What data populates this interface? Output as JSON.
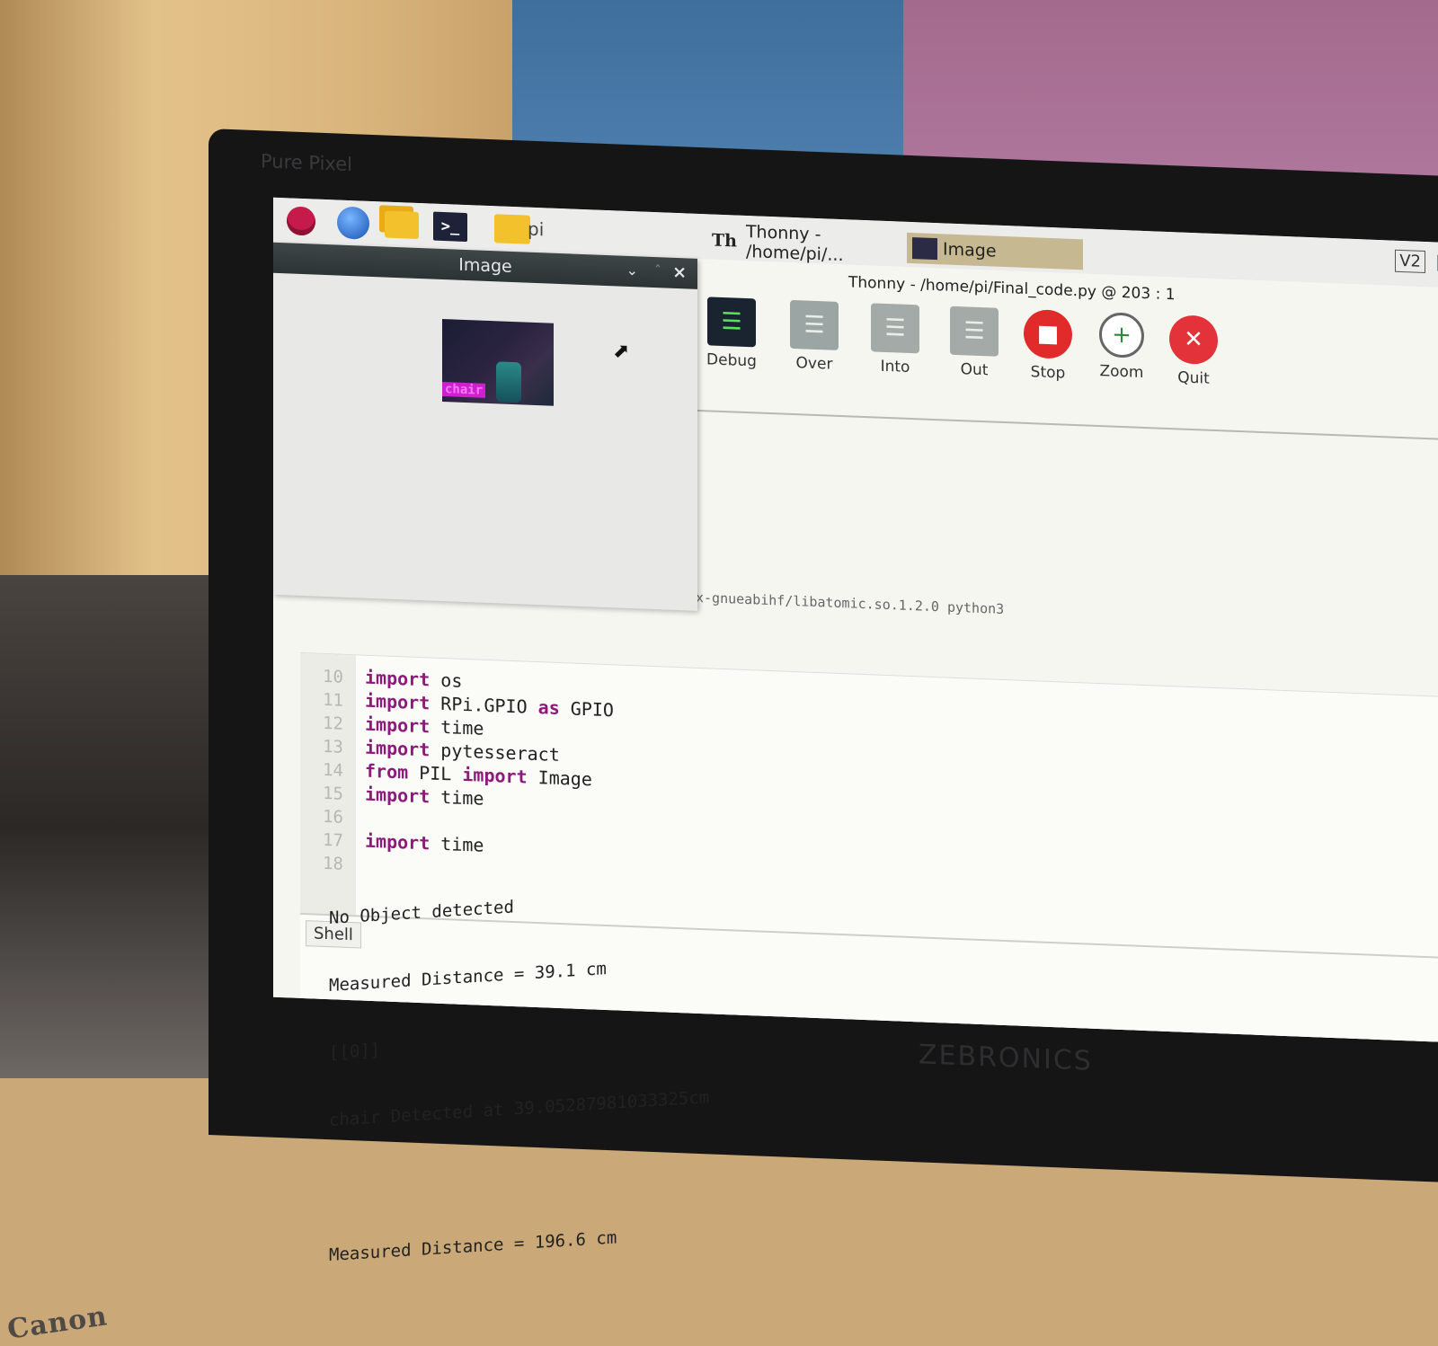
{
  "monitor": {
    "brand_top": "Pure Pixel",
    "brand_bottom": "ZEBRONICS"
  },
  "printer": {
    "brand": "Canon"
  },
  "taskbar": {
    "pi_label": "pi",
    "tasks": [
      {
        "label": "Thonny  -  /home/pi/...",
        "icon": "Th"
      },
      {
        "label": "Image"
      }
    ],
    "tray": {
      "vnc": "V2"
    }
  },
  "thonny": {
    "title": "Thonny  -  /home/pi/Final_code.py  @  203 : 1",
    "toolbar": [
      {
        "label": "Debug"
      },
      {
        "label": "Over"
      },
      {
        "label": "Into"
      },
      {
        "label": "Out"
      },
      {
        "label": "Stop"
      },
      {
        "label": "Zoom"
      },
      {
        "label": "Quit"
      }
    ],
    "partial_line": "x-gnueabihf/libatomic.so.1.2.0 python3",
    "editor": {
      "line_numbers": [
        "10",
        "11",
        "12",
        "13",
        "14",
        "15",
        "16",
        "17",
        "18"
      ],
      "lines": [
        {
          "kw": "import",
          "rest": " os"
        },
        {
          "kw": "import",
          "rest": " RPi.GPIO ",
          "kw2": "as",
          "rest2": " GPIO"
        },
        {
          "kw": "import",
          "rest": " time"
        },
        {
          "kw": "import",
          "rest": " pytesseract"
        },
        {
          "kw": "from",
          "rest": " PIL ",
          "kw2": "import",
          "rest2": " Image"
        },
        {
          "kw": "import",
          "rest": " time"
        },
        {
          "kw": "",
          "rest": ""
        },
        {
          "kw": "import",
          "rest": " time"
        }
      ]
    },
    "shell": {
      "tab": "Shell",
      "lines": [
        "No Object detected",
        "Measured Distance = 39.1 cm",
        "[[0]]",
        "chair Detected at 39.05287981033325cm",
        "",
        "Measured Distance = 196.6 cm"
      ]
    }
  },
  "image_window": {
    "title": "Image",
    "detection_label": "chair"
  }
}
